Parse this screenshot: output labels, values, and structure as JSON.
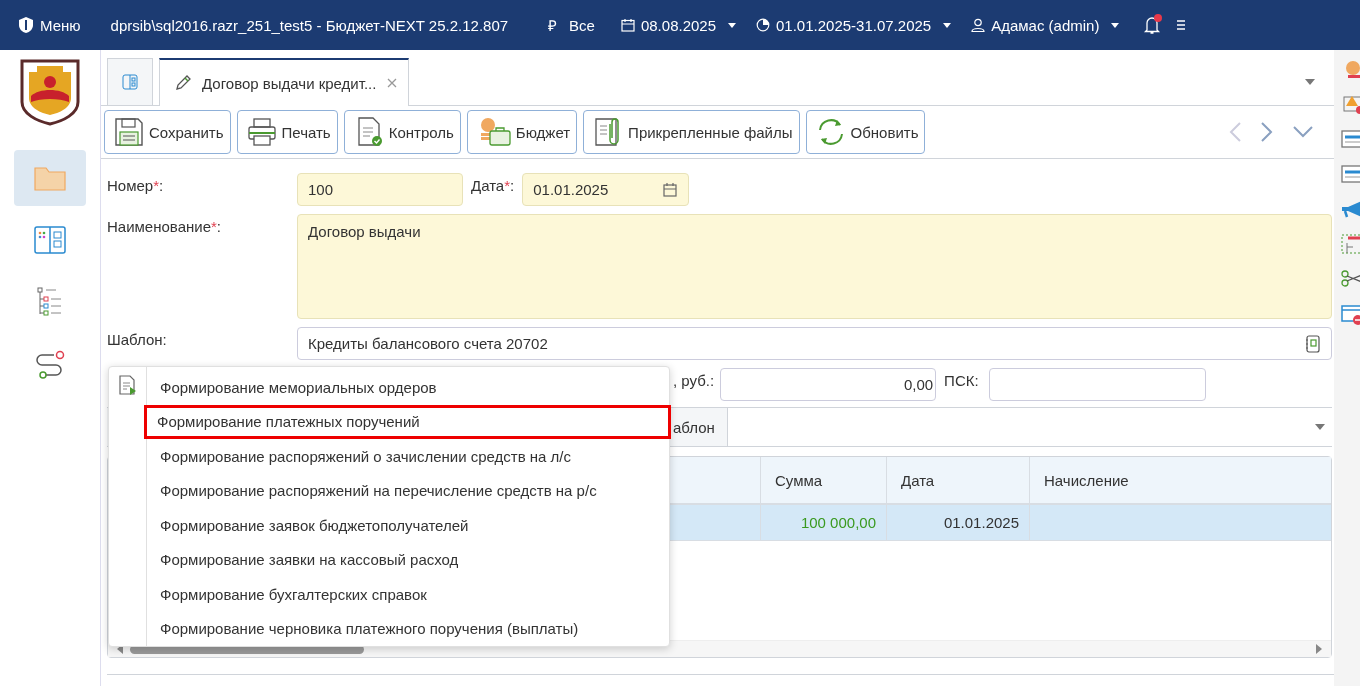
{
  "top_bar": {
    "menu_label": "Меню",
    "title": "dprsib\\sql2016.razr_251_test5 - Бюджет-NEXT 25.2.12.807",
    "currency_symbol": "₽",
    "currency": "Все",
    "date": "08.08.2025",
    "period": "01.01.2025-31.07.2025",
    "user": "Адамас (admin)",
    "notification": true
  },
  "sidebar": {
    "items": [
      {
        "kind": "folder",
        "selected": true
      },
      {
        "kind": "layout",
        "selected": false
      },
      {
        "kind": "tree",
        "selected": false
      },
      {
        "kind": "route",
        "selected": false
      }
    ]
  },
  "tabs": [
    {
      "kind": "home",
      "selected": false
    },
    {
      "kind": "document",
      "label": "Договор выдачи кредит...",
      "selected": true
    }
  ],
  "toolbar": {
    "buttons": [
      {
        "kind": "save",
        "label": "Сохранить"
      },
      {
        "kind": "print",
        "label": "Печать"
      },
      {
        "kind": "control",
        "label": "Контроль"
      },
      {
        "kind": "budget",
        "label": "Бюджет"
      },
      {
        "kind": "files",
        "label": "Прикрепленные файлы"
      },
      {
        "kind": "refresh",
        "label": "Обновить"
      }
    ]
  },
  "form": {
    "number": {
      "label": "Номер",
      "mark": "*",
      "suffix": ":",
      "value": "100"
    },
    "date": {
      "label": "Дата",
      "mark": "*",
      "suffix": ":",
      "value": "01.01.2025"
    },
    "name": {
      "label": "Наименование",
      "mark": "*",
      "suffix": ":",
      "value": "Договор выдачи"
    },
    "template": {
      "label": "Шаблон:",
      "value": "Кредиты балансового счета 20702"
    },
    "amount": {
      "label": ", руб.:",
      "value": "0,00"
    },
    "psk": {
      "label": "ПСК:"
    }
  },
  "detail_tabs": [
    {
      "label": "аблон"
    }
  ],
  "table": {
    "columns": [
      "Сумма",
      "Дата",
      "Начисление"
    ],
    "rows": [
      {
        "selected": true,
        "sum": "100 000,00",
        "date": "01.01.2025"
      }
    ]
  },
  "context_menu": {
    "items": [
      {
        "label": "Формирование мемориальных ордеров",
        "selected": false
      },
      {
        "label": "Формирование платежных поручений",
        "selected": true
      },
      {
        "label": "Формирование распоряжений о зачислении средств на л/с",
        "selected": false
      },
      {
        "label": "Формирование распоряжений на перечисление средств на р/с",
        "selected": false
      },
      {
        "label": "Формирование заявок бюджетополучателей",
        "selected": false
      },
      {
        "label": "Формирование заявки на кассовый расход",
        "selected": false
      },
      {
        "label": "Формирование бухгалтерских справок",
        "selected": false
      },
      {
        "label": "Формирование черновика платежного поручения (выплаты)",
        "selected": false
      }
    ]
  }
}
